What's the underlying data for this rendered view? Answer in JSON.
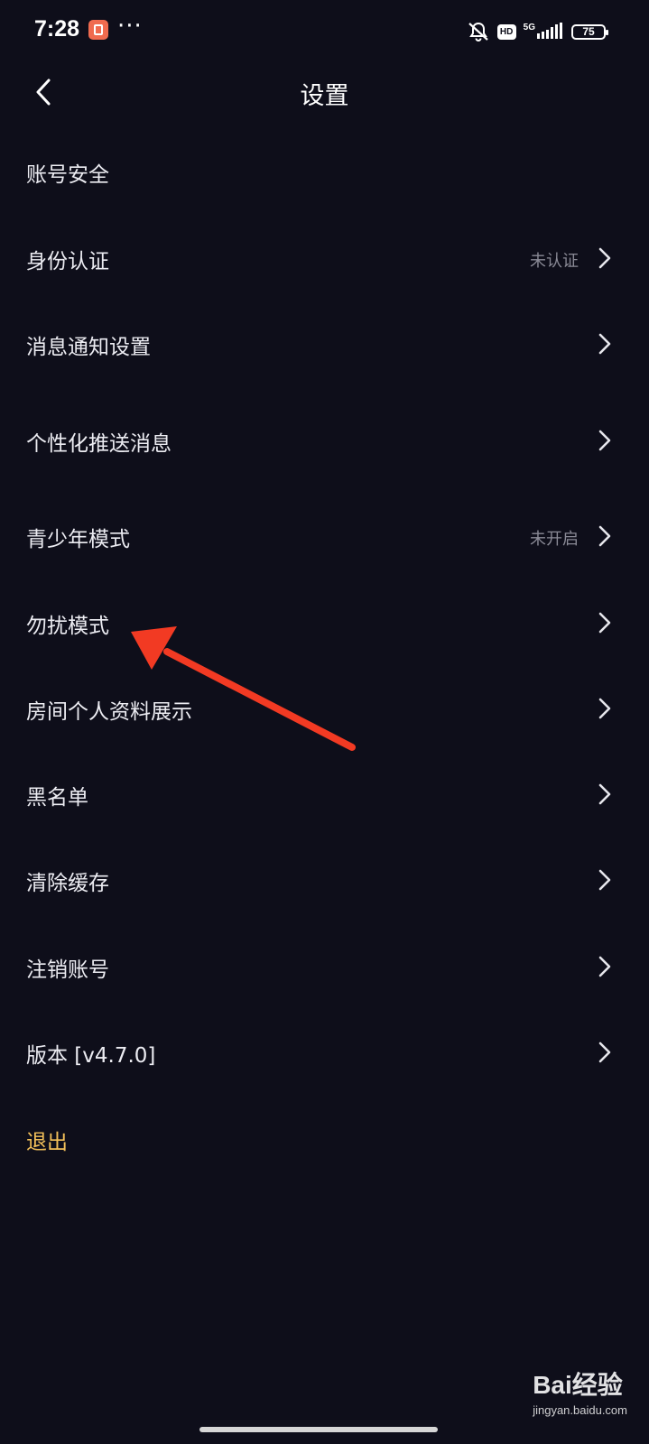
{
  "status_bar": {
    "time": "7:28",
    "more": "···",
    "hd_badge": "HD",
    "network": "5G",
    "battery": "75"
  },
  "header": {
    "title": "设置"
  },
  "settings": {
    "items": [
      {
        "label": "账号安全",
        "value": "",
        "has_chevron": false
      },
      {
        "label": "身份认证",
        "value": "未认证",
        "has_chevron": true
      },
      {
        "label": "消息通知设置",
        "value": "",
        "has_chevron": true
      },
      {
        "label": "个性化推送消息",
        "value": "",
        "has_chevron": true
      },
      {
        "label": "青少年模式",
        "value": "未开启",
        "has_chevron": true
      },
      {
        "label": "勿扰模式",
        "value": "",
        "has_chevron": true
      },
      {
        "label": "房间个人资料展示",
        "value": "",
        "has_chevron": true
      },
      {
        "label": "黑名单",
        "value": "",
        "has_chevron": true
      },
      {
        "label": "清除缓存",
        "value": "",
        "has_chevron": true
      },
      {
        "label": "注销账号",
        "value": "",
        "has_chevron": true
      },
      {
        "label": "版本 [v4.7.0]",
        "value": "",
        "has_chevron": true
      }
    ],
    "logout_label": "退出"
  },
  "colors": {
    "background": "#0e0e1a",
    "text": "#ececf2",
    "secondary_text": "#8a8a96",
    "logout": "#f4c15a",
    "annotation_arrow": "#f23a23"
  },
  "watermark": {
    "logo": "Bai经验",
    "sub": "jingyan.baidu.com"
  }
}
